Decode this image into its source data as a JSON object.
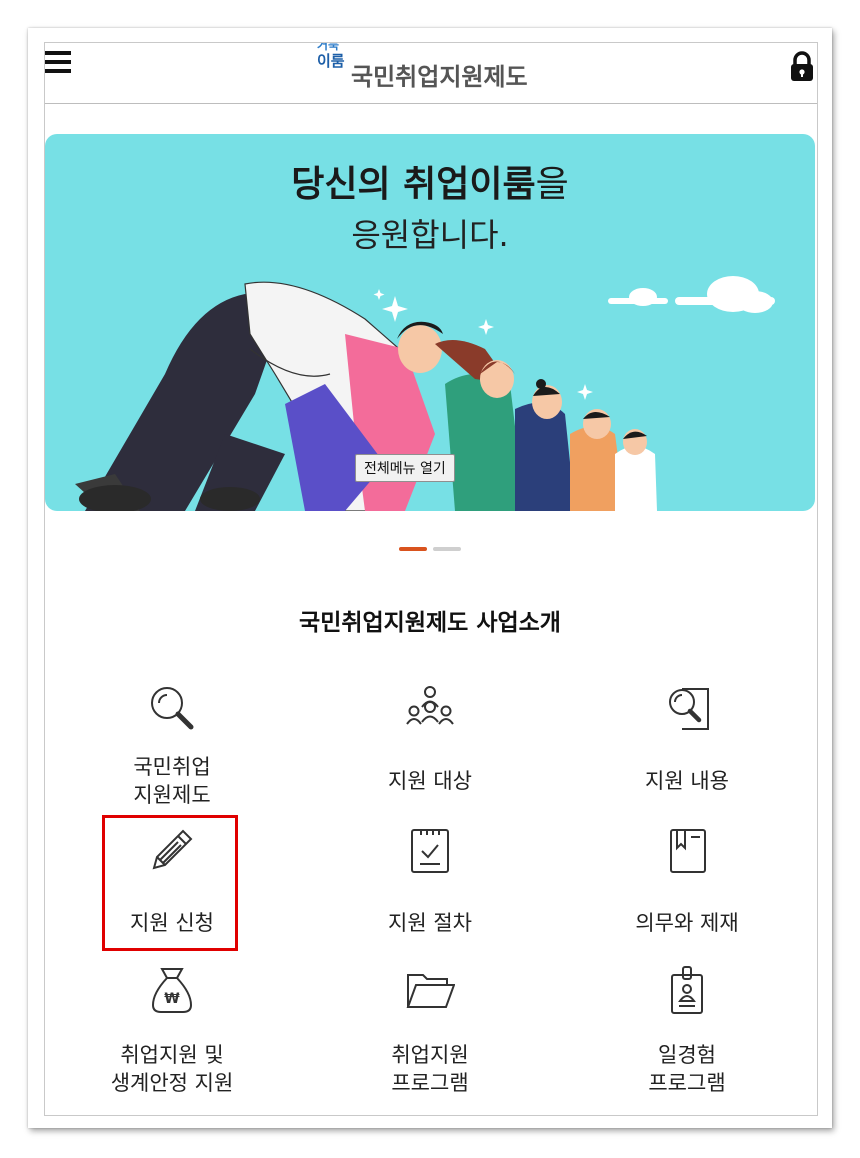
{
  "header": {
    "menu_icon": "hamburger-icon",
    "logo_small_1": "거북",
    "logo_small_2": "이룸",
    "logo_main": "국민취업지원제도",
    "lock_icon": "lock-icon"
  },
  "banner": {
    "title_bold": "당신의 취업이룸",
    "title_rest": "을",
    "subtitle": "응원합니다.",
    "tooltip": "전체메뉴 열기",
    "slide_count": 2,
    "active_slide": 1
  },
  "section": {
    "title": "국민취업지원제도 사업소개"
  },
  "grid": [
    {
      "label": "국민취업\n지원제도",
      "icon": "search-icon"
    },
    {
      "label": "지원 대상",
      "icon": "people-icon"
    },
    {
      "label": "지원 내용",
      "icon": "document-search-icon"
    },
    {
      "label": "지원 신청",
      "icon": "pencil-icon"
    },
    {
      "label": "지원 절차",
      "icon": "checklist-icon"
    },
    {
      "label": "의무와 제재",
      "icon": "book-icon"
    },
    {
      "label": "취업지원 및\n생계안정 지원",
      "icon": "money-bag-icon"
    },
    {
      "label": "취업지원\n프로그램",
      "icon": "folder-icon"
    },
    {
      "label": "일경험\n프로그램",
      "icon": "badge-icon"
    }
  ],
  "colors": {
    "banner_bg": "#77e0e5",
    "active_dot": "#d9531e",
    "highlight": "#e00000"
  }
}
